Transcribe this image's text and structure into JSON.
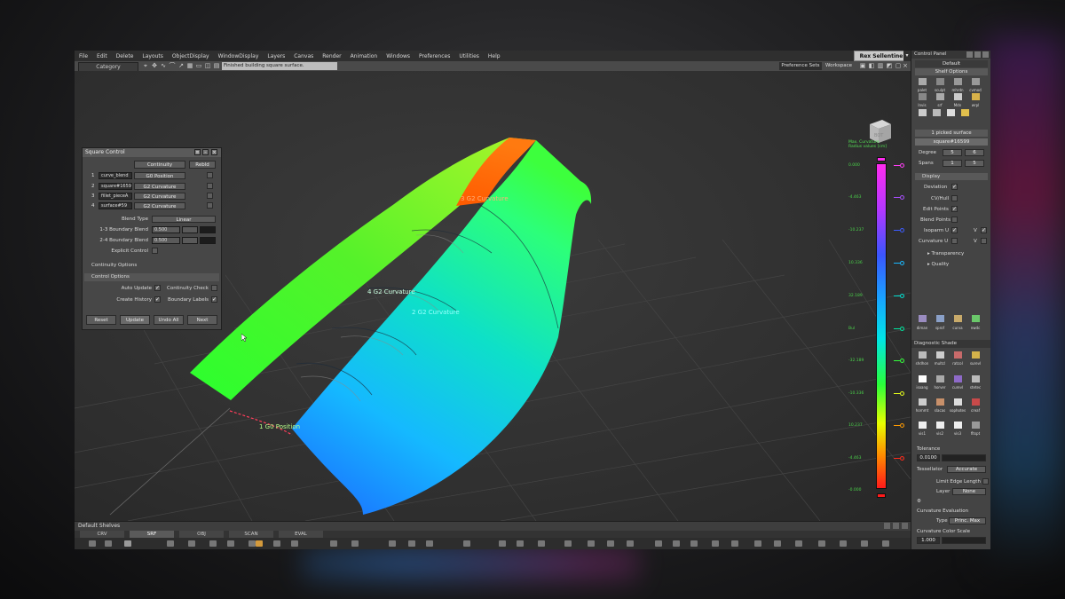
{
  "menubar": {
    "items": [
      "File",
      "Edit",
      "Delete",
      "Layouts",
      "ObjectDisplay",
      "WindowDisplay",
      "Layers",
      "Canvas",
      "Render",
      "Animation",
      "Windows",
      "Preferences",
      "Utilities",
      "Help"
    ],
    "user": "Rex Sellentine"
  },
  "toolbar": {
    "category": "Category",
    "status_message": "Finished building square surface.",
    "preference_sets": "Preference Sets",
    "workspace": "Workspace"
  },
  "square_control": {
    "title": "Square Control",
    "continuity_button": "Continuity",
    "rebld_button": "Rebld",
    "rows": [
      {
        "num": "1",
        "name": "curve_blend",
        "continuity": "G0 Position"
      },
      {
        "num": "2",
        "name": "square#16599",
        "continuity": "G2 Curvature"
      },
      {
        "num": "3",
        "name": "fillet_pieceA",
        "continuity": "G2 Curvature"
      },
      {
        "num": "4",
        "name": "surface#59",
        "continuity": "G2 Curvature"
      }
    ],
    "blend_type_label": "Blend Type",
    "blend_type_value": "Linear",
    "boundary_13_label": "1-3 Boundary Blend",
    "boundary_13_value": "0.500",
    "boundary_24_label": "2-4 Boundary Blend",
    "boundary_24_value": "0.500",
    "explicit_control_label": "Explicit Control",
    "continuity_options": "Continuity Options",
    "control_options": "Control Options",
    "auto_update": "Auto Update",
    "continuity_check": "Continuity Check",
    "create_history": "Create History",
    "boundary_labels": "Boundary Labels",
    "buttons": {
      "reset": "Reset",
      "update": "Update",
      "undo_all": "Undo All",
      "next": "Next"
    }
  },
  "viewport": {
    "labels": {
      "g2_top": "3 G2 Curvature",
      "g2_mid": "4 G2 Curvature",
      "g2_right": "2 G2 Curvature",
      "g0": "1 G0 Position"
    },
    "legend": {
      "title_line1": "Max. Curvature",
      "title_line2": "Radius values [cm]",
      "ticks": [
        "0.000",
        "-4.463",
        "-10.237",
        "10.336",
        "32.189",
        "Bul",
        "-32.189",
        "-10.336",
        "10.237",
        "-4.463",
        "-0.000"
      ]
    },
    "colors": {
      "marker_magenta": "#ff3cf5",
      "marker_purple": "#a94dff",
      "marker_blue": "#3b5bff",
      "marker_cyan": "#19b8ff",
      "marker_teal": "#00e0d0",
      "marker_green": "#33ff3a",
      "marker_yellow": "#e6ff1a",
      "marker_orange": "#ff9a00",
      "marker_red": "#ff2a1a"
    }
  },
  "shelves": {
    "title": "Default Shelves",
    "tabs": [
      "CRV",
      "SRF",
      "OBJ",
      "SCAN",
      "EVAL"
    ],
    "active_tab": "SRF"
  },
  "right_panel": {
    "header": "Control Panel",
    "default_label": "Default",
    "shelf_options": "Shelf Options",
    "shelf_icon_labels": [
      "palet",
      "sculpt",
      "mhrdn",
      "cvmod",
      "lnvis",
      "srf",
      "Mdn",
      "wrpl"
    ],
    "picked": "1 picked surface",
    "surface_name": "square#16599",
    "degree_label": "Degree",
    "degree_u": "5",
    "degree_v": "6",
    "spans_label": "Spans",
    "spans_u": "1",
    "spans_v": "5",
    "display_label": "Display",
    "deviation": "Deviation",
    "cv_hull": "CV/Hull",
    "edit_points": "Edit Points",
    "blend_points": "Blend Points",
    "isoparm_u": "Isoparm U",
    "curvature_u": "Curvature U",
    "v_label": "V",
    "transparency": "Transparency",
    "quality": "Quality",
    "tool_labels": [
      "diman",
      "sprof",
      "curva",
      "nwdc"
    ],
    "diag_header": "Diagnostic Shade",
    "diag_labels": [
      "shdhon",
      "multcl",
      "ratcol",
      "surevl",
      "isoang",
      "horver",
      "curevl",
      "stetec",
      "hornmt",
      "slacas",
      "sophotes",
      "creaf",
      "vis1",
      "vis2",
      "vis3",
      "fltspt"
    ],
    "tolerance_label": "Tolerance",
    "tolerance_value": "0.0100",
    "tessellator_label": "Tessellator",
    "tessellator_value": "Accurate",
    "limit_edge": "Limit Edge Length",
    "layer_label": "Layer",
    "layer_value": "None",
    "curv_eval": "Curvature Evaluation",
    "type_label": "Type",
    "type_value": "Princ. Max",
    "curv_scale": "Curvature Color Scale",
    "curv_scale_value": "1.000"
  }
}
